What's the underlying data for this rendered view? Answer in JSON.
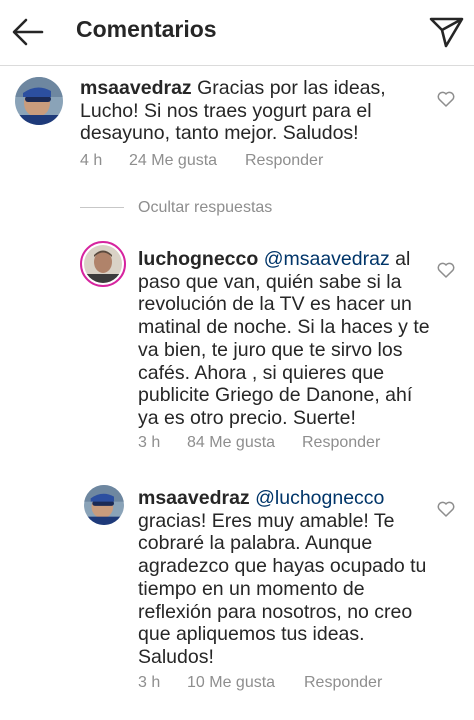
{
  "header": {
    "title": "Comentarios"
  },
  "comments": [
    {
      "username": "msaavedraz",
      "mention": "",
      "line_1": "Gracias por las ideas,",
      "line_2": "Lucho! Si nos traes yogurt para el",
      "line_3": "desayuno, tanto mejor. Saludos!",
      "time": "4 h",
      "likes": "24 Me gusta",
      "reply": "Responder"
    },
    {
      "username": "luchognecco",
      "mention": "@msaavedraz",
      "line_1": "al",
      "line_2": "paso que van, quién sabe si la",
      "line_3": "revolución de la TV es hacer un",
      "line_4": "matinal de noche. Si la haces y te",
      "line_5": "va bien, te juro que te sirvo los",
      "line_6": "cafés. Ahora , si quieres que",
      "line_7": "publicite Griego de Danone, ahí",
      "line_8": "ya es otro precio.  Suerte!",
      "time": "3 h",
      "likes": "84 Me gusta",
      "reply": "Responder"
    },
    {
      "username": "msaavedraz",
      "mention": "@luchognecco",
      "line_1": "",
      "line_2": "gracias! Eres muy amable! Te",
      "line_3": "cobraré la palabra. Aunque",
      "line_4": "agradezco que hayas ocupado tu",
      "line_5": "tiempo en un momento de",
      "line_6": "reflexión para nosotros, no creo",
      "line_7": "que apliquemos tus ideas.",
      "line_8": "Saludos!",
      "time": "3 h",
      "likes": "10 Me gusta",
      "reply": "Responder"
    }
  ],
  "hide_replies_label": "Ocultar respuestas",
  "icons": {
    "back": "arrow-left-icon",
    "send": "paper-plane-icon",
    "like": "heart-outline-icon"
  }
}
